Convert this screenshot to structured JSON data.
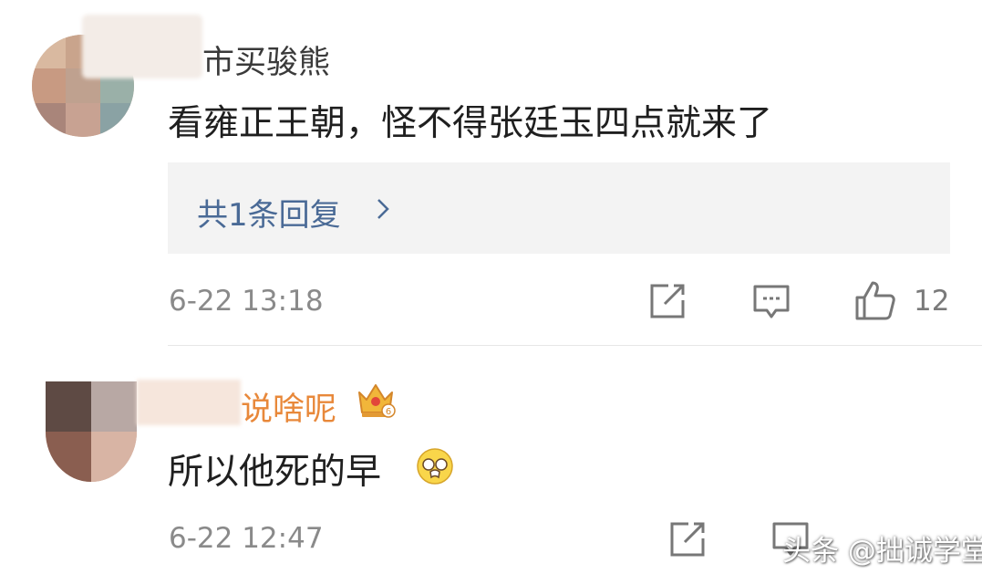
{
  "comments": [
    {
      "username": "市买骏熊",
      "text": "看雍正王朝，怪不得张廷玉四点就来了",
      "reply_label": "共1条回复",
      "time": "6-22 13:18",
      "like_count": "12"
    },
    {
      "username": "说啥呢",
      "text": "所以他死的早",
      "time": "6-22 12:47"
    }
  ],
  "watermark": "头条 @拙诚学堂",
  "colors": {
    "username_default": "#3a3a3a",
    "username_vip": "#e8883a",
    "reply_link": "#4a6a96",
    "meta_gray": "#8a8a8a"
  },
  "icons": [
    "share-icon",
    "comment-icon",
    "like-icon",
    "crown-badge-icon",
    "emoji-icon",
    "chevron-right-icon"
  ]
}
